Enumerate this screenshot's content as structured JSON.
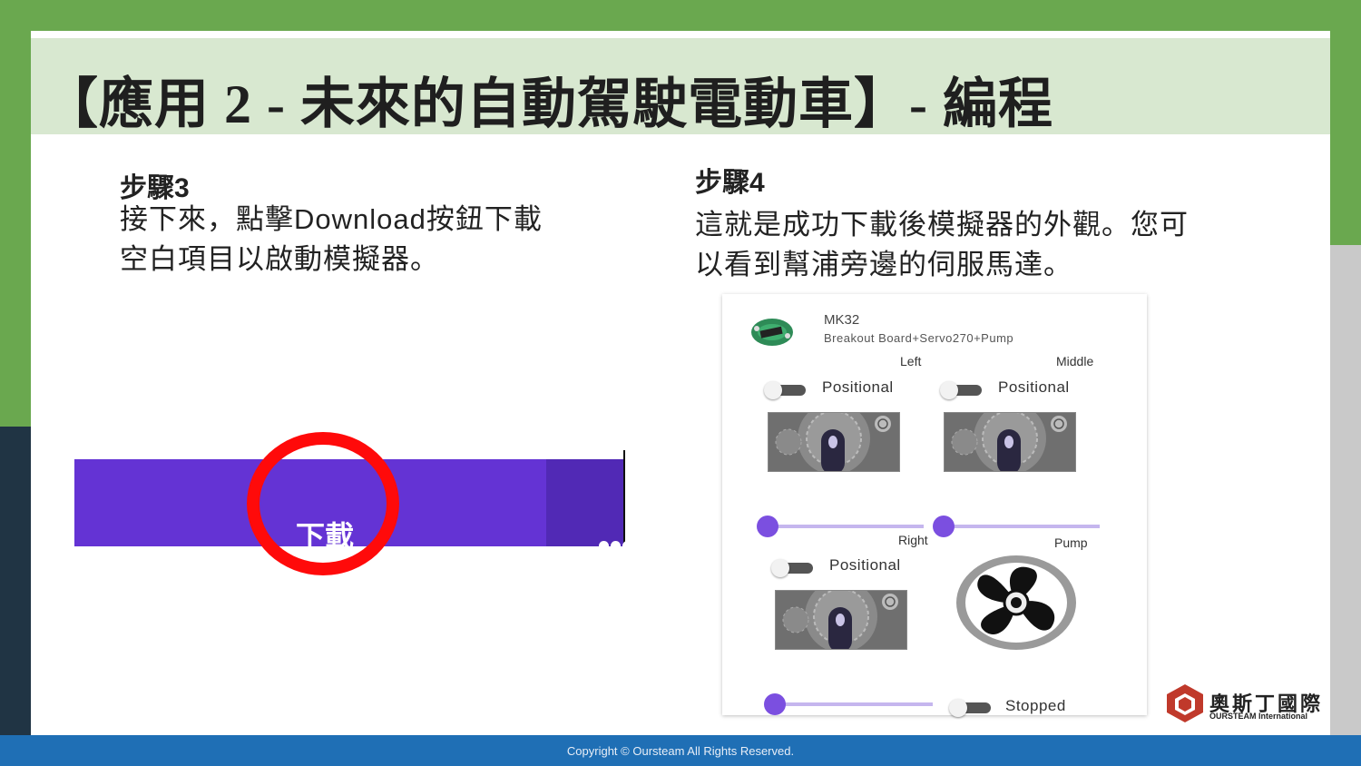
{
  "title": "【應用 2 - 未來的自動駕駛電動車】- 編程",
  "step3": {
    "heading": "步驟3",
    "line1": "接下來，點擊Download按鈕下載",
    "line2": "空白項目以啟動模擬器。"
  },
  "step4": {
    "heading": "步驟4",
    "line1": "這就是成功下載後模擬器的外觀。您可",
    "line2": "以看到幫浦旁邊的伺服馬達。"
  },
  "download_button": {
    "label": "下載",
    "more_icon": "more-dots-icon"
  },
  "simulator": {
    "board_name": "MK32",
    "board_sub": "Breakout Board+Servo270+Pump",
    "servos": [
      {
        "name": "Left",
        "mode": "Positional"
      },
      {
        "name": "Middle",
        "mode": "Positional"
      },
      {
        "name": "Right",
        "mode": "Positional"
      }
    ],
    "pump": {
      "name": "Pump",
      "status": "Stopped"
    }
  },
  "logo": {
    "name": "奧斯丁國際",
    "sub": "OURSTEAM International"
  },
  "footer": "Copyright © Oursteam All Rights Reserved.",
  "colors": {
    "button": "#6433d4",
    "highlight": "#ff0a0a",
    "slider": "#7b4fe0",
    "footer": "#1f6fb5",
    "header_band": "#d8e8d0"
  }
}
